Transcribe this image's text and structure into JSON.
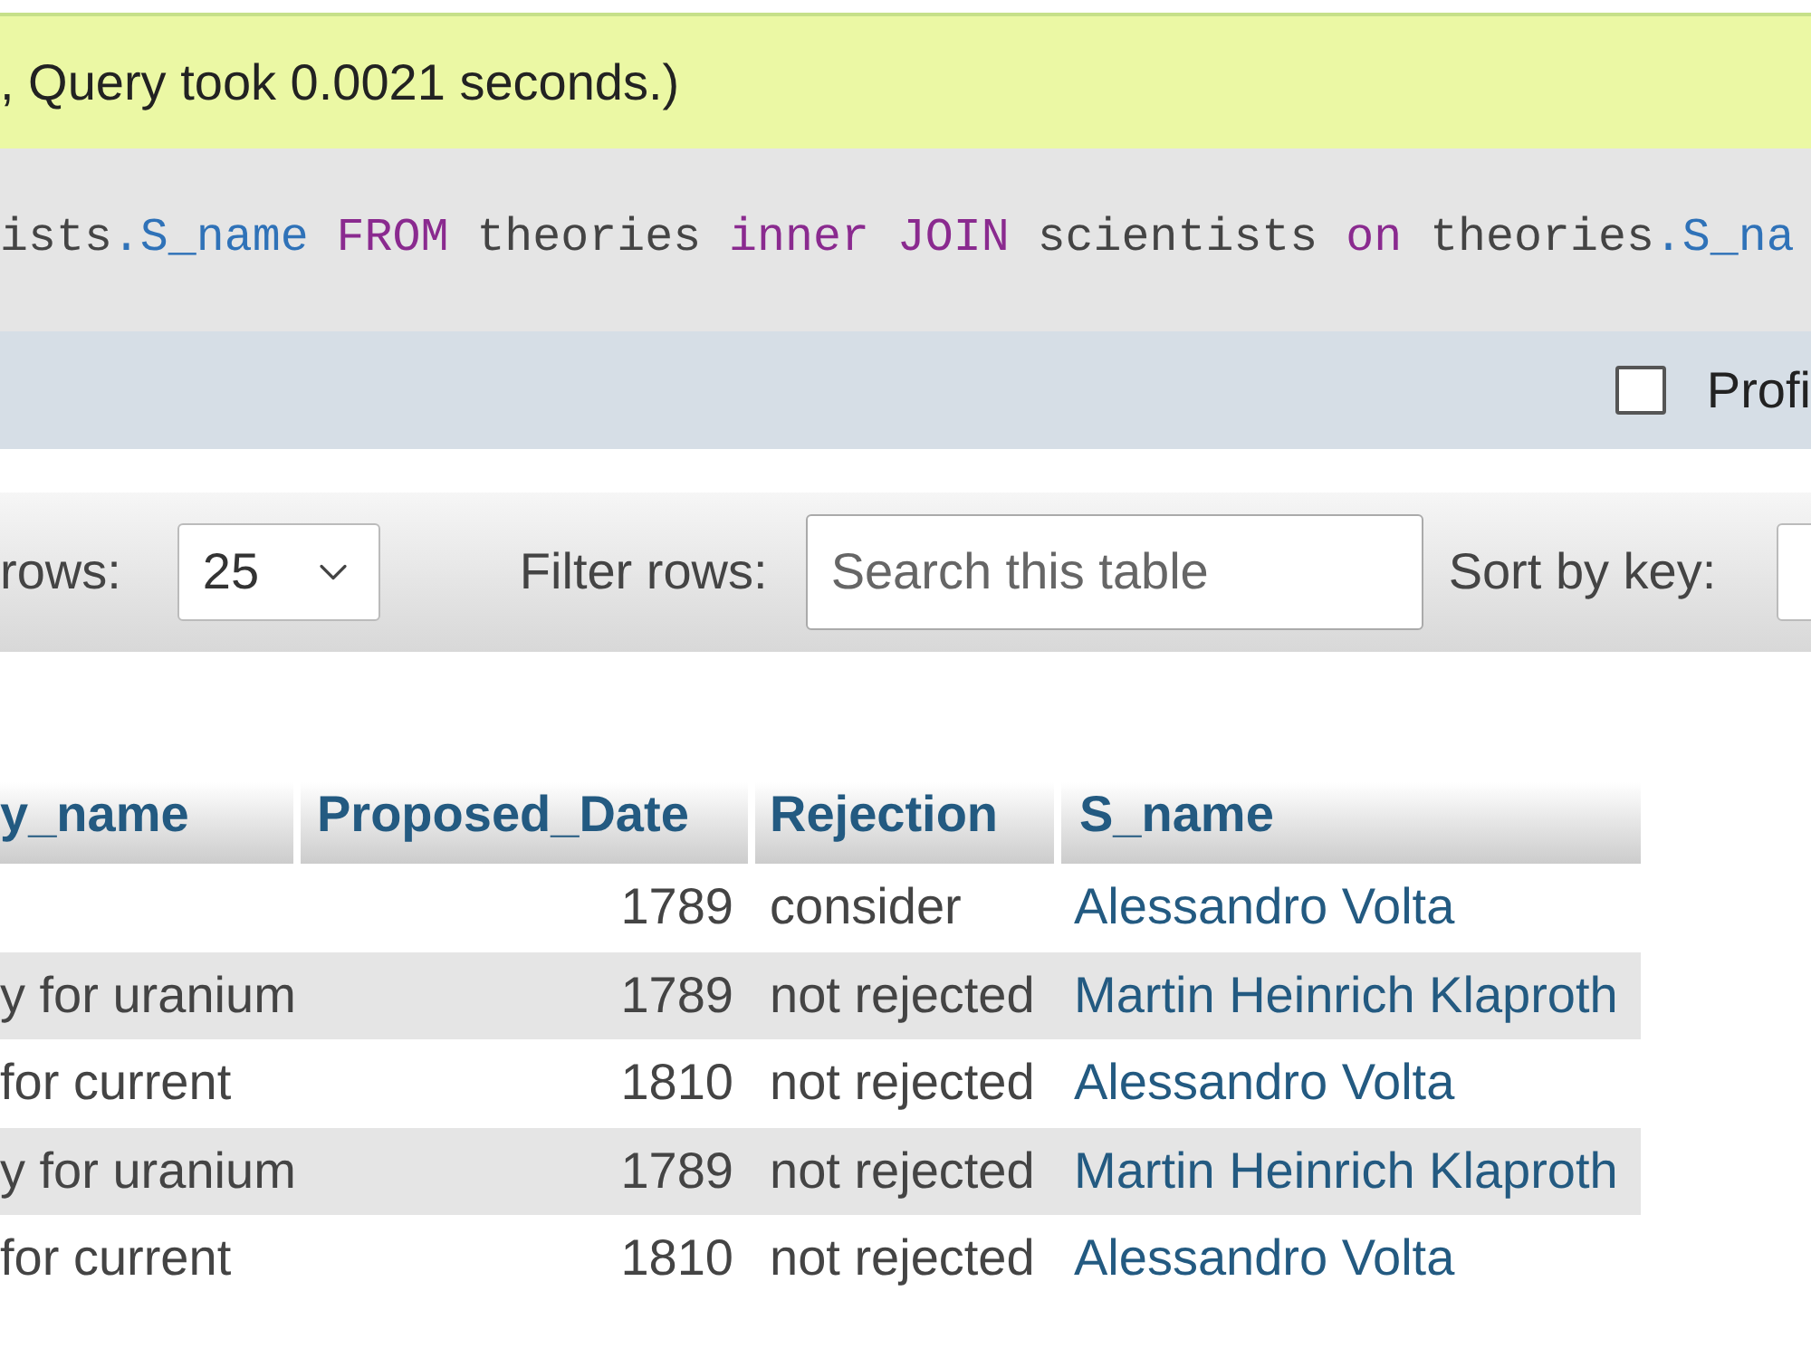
{
  "success_message": {
    "text": ", Query took 0.0021 seconds.)"
  },
  "sql_query": {
    "tokens": [
      {
        "text": "ists",
        "kind": "plain"
      },
      {
        "text": ".S_name",
        "kind": "field"
      },
      {
        "text": " FROM ",
        "kind": "keyword"
      },
      {
        "text": "theories ",
        "kind": "plain"
      },
      {
        "text": "inner JOIN ",
        "kind": "keyword"
      },
      {
        "text": "scientists ",
        "kind": "plain"
      },
      {
        "text": "on ",
        "kind": "keyword"
      },
      {
        "text": "theories",
        "kind": "plain"
      },
      {
        "text": ".S_na",
        "kind": "field"
      }
    ]
  },
  "options_bar": {
    "profiling": {
      "label": "Profi",
      "checked": false
    }
  },
  "navigation": {
    "rows_label": "rows:",
    "rows_select": {
      "value": "25"
    },
    "filter_label": "Filter rows:",
    "filter_input": {
      "placeholder": "Search this table"
    },
    "sort_label": "Sort by key:"
  },
  "table": {
    "columns": [
      "y_name",
      "Proposed_Date",
      "Rejection",
      "S_name"
    ],
    "rows": [
      {
        "proposed_date": "1789",
        "rejection": "consider",
        "s_name": "Alessandro Volta"
      },
      {
        "column_1": "y for uranium",
        "proposed_date": "1789",
        "rejection": "not rejected",
        "s_name": "Martin Heinrich Klaproth"
      },
      {
        "column_1": "for current",
        "proposed_date": "1810",
        "rejection": "not rejected",
        "s_name": "Alessandro Volta"
      },
      {
        "column_1": "y for uranium",
        "proposed_date": "1789",
        "rejection": "not rejected",
        "s_name": "Martin Heinrich Klaproth"
      },
      {
        "column_1": "for current",
        "proposed_date": "1810",
        "rejection": "not rejected",
        "s_name": "Alessandro Volta"
      }
    ]
  }
}
